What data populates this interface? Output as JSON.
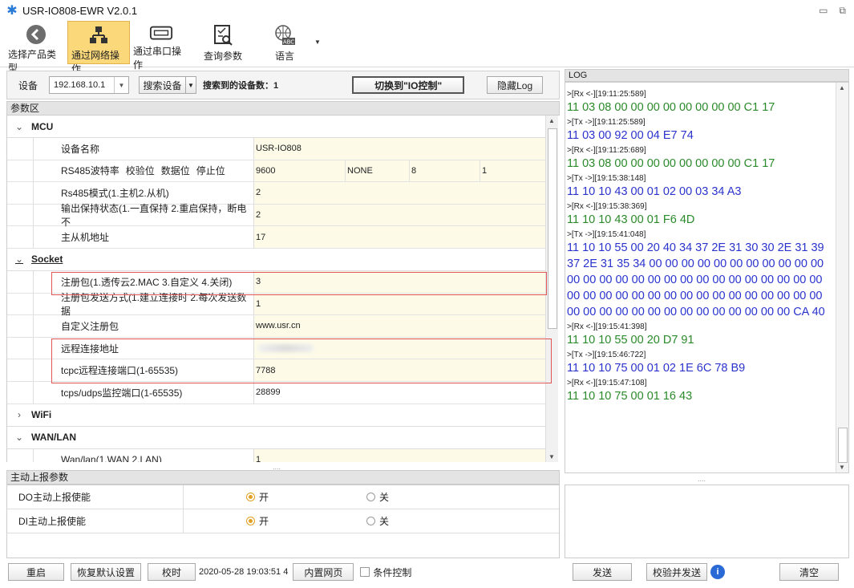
{
  "window": {
    "title": "USR-IO808-EWR V2.0.1"
  },
  "toolbar": {
    "items": [
      {
        "label": "选择产品类型",
        "icon": "back-arrow-icon",
        "active": false
      },
      {
        "label": "通过网络操作",
        "icon": "network-icon",
        "active": true
      },
      {
        "label": "通过串口操作",
        "icon": "serial-port-icon",
        "active": false
      },
      {
        "label": "查询参数",
        "icon": "query-icon",
        "active": false
      },
      {
        "label": "语言",
        "icon": "language-icon",
        "active": false
      }
    ],
    "lang_badge": "ABC"
  },
  "device_bar": {
    "device_label": "设备",
    "ip_value": "192.168.10.1",
    "search_button": "搜索设备",
    "found_text": "搜索到的设备数：1",
    "switch_button": "切换到\"IO控制\"",
    "hide_log_button": "隐藏Log"
  },
  "params": {
    "title": "参数区",
    "sections": {
      "mcu": "MCU",
      "socket": "Socket",
      "wifi": "WiFi",
      "wanlan": "WAN/LAN"
    },
    "mcu_rows": {
      "device_name_key": "设备名称",
      "device_name_val": "USR-IO808",
      "serial_keys": [
        "RS485波特率",
        "校验位",
        "数据位",
        "停止位"
      ],
      "serial_vals": [
        "9600",
        "NONE",
        "8",
        "1"
      ],
      "rs485_mode_key": "Rs485模式(1.主机2.从机)",
      "rs485_mode_val": "2",
      "output_hold_key": "输出保持状态(1.一直保持 2.重启保持，断电不",
      "output_hold_val": "2",
      "address_key": "主从机地址",
      "address_val": "17"
    },
    "socket_rows": {
      "reg_pkg_key": "注册包(1.透传云2.MAC 3.自定义 4.关闭)",
      "reg_pkg_val": "3",
      "reg_send_key": "注册包发送方式(1.建立连接时 2.每次发送数据",
      "reg_send_val": "1",
      "custom_reg_key": "自定义注册包",
      "custom_reg_val": "www.usr.cn",
      "remote_addr_key": "远程连接地址",
      "tcpc_port_key": "tcpc远程连接端口(1-65535)",
      "tcpc_port_val": "7788",
      "tcps_port_key": "tcps/udps监控端口(1-65535)",
      "tcps_port_val": "28899"
    },
    "wanlan_rows": {
      "wanlan_key": "Wan/lan(1.WAN 2.LAN)",
      "wanlan_val": "1"
    },
    "splitter": "...."
  },
  "report": {
    "title": "主动上报参数",
    "rows": [
      {
        "key": "DO主动上报使能",
        "on": "开",
        "off": "关"
      },
      {
        "key": "DI主动上报使能",
        "on": "开",
        "off": "关"
      }
    ]
  },
  "bottom": {
    "restart": "重启",
    "restore": "恢复默认设置",
    "sync_time": "校时",
    "datetime": "2020-05-28 19:03:51 4",
    "web": "内置网页",
    "condition": "条件控制"
  },
  "log": {
    "title": "LOG",
    "entries": [
      {
        "meta": ">[Rx <-][19:11:25:589]",
        "data": "11 03 08 00 00 00 00 00 00 00 00 C1 17",
        "dir": "rx"
      },
      {
        "meta": ">[Tx ->][19:11:25:589]",
        "data": "11 03 00 92 00 04 E7 74",
        "dir": "tx"
      },
      {
        "meta": ">[Rx <-][19:11:25:689]",
        "data": "11 03 08 00 00 00 00 00 00 00 00 C1 17",
        "dir": "rx"
      },
      {
        "meta": ">[Tx ->][19:15:38:148]",
        "data": "11 10 10 43 00 01 02 00 03 34 A3",
        "dir": "tx"
      },
      {
        "meta": ">[Rx <-][19:15:38:369]",
        "data": "11 10 10 43 00 01 F6 4D",
        "dir": "rx"
      },
      {
        "meta": ">[Tx ->][19:15:41:048]",
        "data": "11 10 10 55 00 20 40 34 37 2E 31 30 30 2E 31 39 37 2E 31 35 34 00 00 00 00 00 00 00 00 00 00 00 00 00 00 00 00 00 00 00 00 00 00 00 00 00 00 00 00 00 00 00 00 00 00 00 00 00 00 00 00 00 00 00 00 00 00 00 00 00 00 00 00 00 00 00 00 00 CA 40",
        "dir": "tx"
      },
      {
        "meta": ">[Rx <-][19:15:41:398]",
        "data": "11 10 10 55 00 20 D7 91",
        "dir": "rx"
      },
      {
        "meta": ">[Tx ->][19:15:46:722]",
        "data": "11 10 10 75 00 01 02 1E 6C 78 B9",
        "dir": "tx"
      },
      {
        "meta": ">[Rx <-][19:15:47:108]",
        "data": "11 10 10 75 00 01 16 43",
        "dir": "rx"
      }
    ],
    "splitter": "....",
    "send": "发送",
    "verify_send": "校验并发送",
    "clear": "清空"
  },
  "colors": {
    "rx": "#2a8a2a",
    "tx": "#2a33cc",
    "active_tab": "#fbd87a",
    "highlight": "#e05555"
  }
}
